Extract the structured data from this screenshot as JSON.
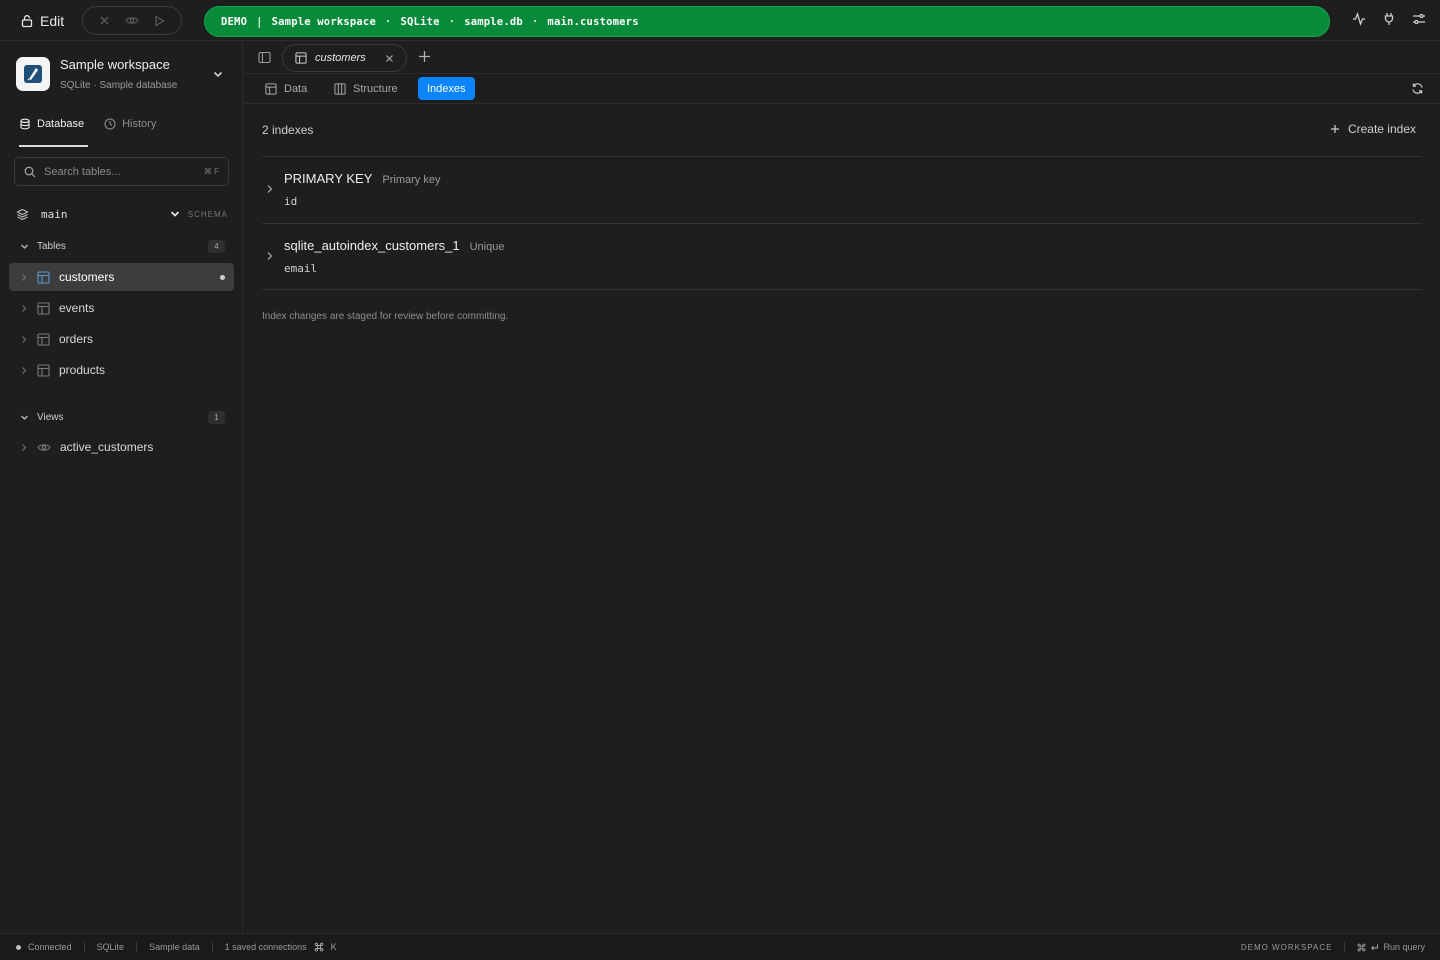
{
  "topbar": {
    "edit_label": "Edit",
    "banner": {
      "badge": "DEMO",
      "workspace": "Sample workspace",
      "engine": "SQLite",
      "file": "sample.db",
      "table": "main.customers"
    }
  },
  "sidebar": {
    "workspace_name": "Sample workspace",
    "workspace_sub": "SQLite · Sample database",
    "tabs": [
      {
        "label": "Database",
        "icon": "database-icon"
      },
      {
        "label": "History",
        "icon": "clock-icon"
      }
    ],
    "search": {
      "placeholder": "Search tables...",
      "shortcut": "⌘ F"
    },
    "schema": {
      "name": "main",
      "label": "SCHEMA"
    },
    "tables_section": {
      "label": "Tables",
      "count": "4"
    },
    "tables": [
      {
        "name": "customers",
        "active": true
      },
      {
        "name": "events"
      },
      {
        "name": "orders"
      },
      {
        "name": "products"
      }
    ],
    "views_section": {
      "label": "Views",
      "count": "1"
    },
    "views": [
      {
        "name": "active_customers"
      }
    ]
  },
  "main": {
    "open_tab": "customers",
    "subtabs": [
      "Data",
      "Structure",
      "Indexes"
    ],
    "active_subtab": "Indexes",
    "index_count": "2 indexes",
    "create_label": "Create index",
    "indexes": [
      {
        "name": "PRIMARY KEY",
        "kind": "Primary key",
        "columns": "id"
      },
      {
        "name": "sqlite_autoindex_customers_1",
        "kind": "Unique",
        "columns": "email"
      }
    ],
    "note": "Index changes are staged for review before committing."
  },
  "statusbar": {
    "connected": "Connected",
    "engine": "SQLite",
    "dataset": "Sample data",
    "connections": "1 saved connections",
    "conn_shortcut_key": "K",
    "workspace": "DEMO WORKSPACE",
    "run_query": "Run query"
  },
  "colors": {
    "banner_bg": "#078a3a",
    "accent": "#0a84ff",
    "background": "#1e1e1e"
  }
}
